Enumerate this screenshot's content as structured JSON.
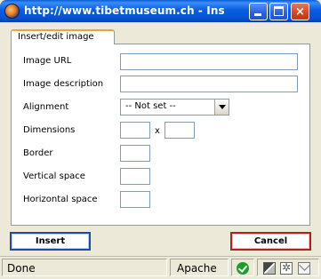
{
  "window": {
    "title": "http://www.tibetmuseum.ch - Ins",
    "controls": {
      "minimize": "minimize-icon",
      "maximize": "maximize-icon",
      "close": "×"
    }
  },
  "tab": {
    "label": "Insert/edit image"
  },
  "form": {
    "image_url": {
      "label": "Image URL",
      "value": ""
    },
    "image_description": {
      "label": "Image description",
      "value": ""
    },
    "alignment": {
      "label": "Alignment",
      "selected": "-- Not set --"
    },
    "dimensions": {
      "label": "Dimensions",
      "separator": "x",
      "width": "",
      "height": ""
    },
    "border": {
      "label": "Border",
      "value": ""
    },
    "vertical_space": {
      "label": "Vertical space",
      "value": ""
    },
    "horizontal_space": {
      "label": "Horizontal space",
      "value": ""
    }
  },
  "buttons": {
    "insert": "Insert",
    "cancel": "Cancel"
  },
  "statusbar": {
    "status": "Done",
    "server": "Apache",
    "icons": [
      "ok-icon",
      "dom-inspector-icon",
      "extension-icon",
      "mail-icon"
    ]
  }
}
